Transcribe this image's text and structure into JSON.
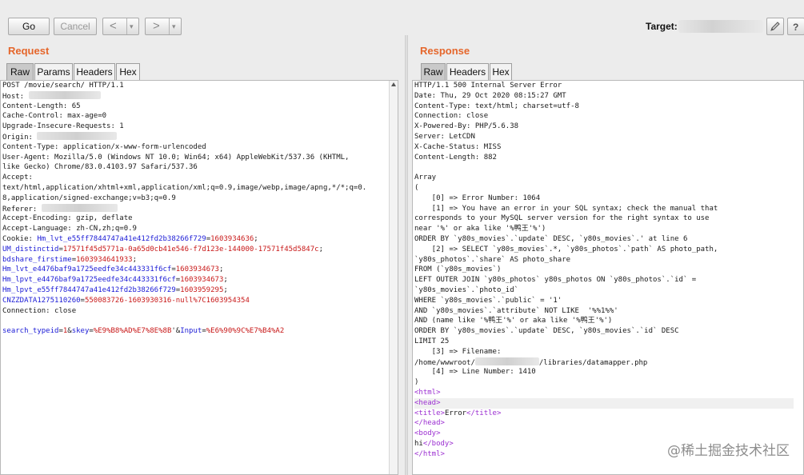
{
  "toolbar": {
    "go_label": "Go",
    "cancel_label": "Cancel",
    "back_glyph": "<",
    "forward_glyph": ">",
    "dropdown_glyph": "▾",
    "target_label": "Target:",
    "edit_icon": "pencil-icon",
    "help_icon": "help-icon"
  },
  "request": {
    "title": "Request",
    "tabs": [
      "Raw",
      "Params",
      "Headers",
      "Hex"
    ],
    "active_tab": "Raw",
    "lines": [
      [
        {
          "t": "POST /movie/search/ HTTP/1.1",
          "c": "hk"
        }
      ],
      [
        {
          "t": "Host: ",
          "c": "hk"
        },
        {
          "r": 90
        }
      ],
      [
        {
          "t": "Content-Length: 65",
          "c": "hk"
        }
      ],
      [
        {
          "t": "Cache-Control: max-age=0",
          "c": "hk"
        }
      ],
      [
        {
          "t": "Upgrade-Insecure-Requests: 1",
          "c": "hk"
        }
      ],
      [
        {
          "t": "Origin: ",
          "c": "hk"
        },
        {
          "r": 100
        }
      ],
      [
        {
          "t": "Content-Type: application/x-www-form-urlencoded",
          "c": "hk"
        }
      ],
      [
        {
          "t": "User-Agent: Mozilla/5.0 (Windows NT 10.0; Win64; x64) AppleWebKit/537.36 (KHTML,",
          "c": "hk"
        }
      ],
      [
        {
          "t": "like Gecko) Chrome/83.0.4103.97 Safari/537.36",
          "c": "hk"
        }
      ],
      [
        {
          "t": "Accept:",
          "c": "hk"
        }
      ],
      [
        {
          "t": "text/html,application/xhtml+xml,application/xml;q=0.9,image/webp,image/apng,*/*;q=0.",
          "c": "hk"
        }
      ],
      [
        {
          "t": "8,application/signed-exchange;v=b3;q=0.9",
          "c": "hk"
        }
      ],
      [
        {
          "t": "Referer: ",
          "c": "hk"
        },
        {
          "r": 95
        }
      ],
      [
        {
          "t": "Accept-Encoding: gzip, deflate",
          "c": "hk"
        }
      ],
      [
        {
          "t": "Accept-Language: zh-CN,zh;q=0.9",
          "c": "hk"
        }
      ],
      [
        {
          "t": "Cookie: ",
          "c": "hk"
        },
        {
          "t": "Hm_lvt_e55ff7844747a41e412fd2b38266f729",
          "c": "ck"
        },
        {
          "t": "=",
          "c": "hk"
        },
        {
          "t": "1603934636",
          "c": "cv"
        },
        {
          "t": ";",
          "c": "hk"
        }
      ],
      [
        {
          "t": "UM_distinctid",
          "c": "ck"
        },
        {
          "t": "=",
          "c": "hk"
        },
        {
          "t": "17571f45d5771a-0a65d0cb41e546-f7d123e-144000-17571f45d5847c",
          "c": "cv"
        },
        {
          "t": ";",
          "c": "hk"
        }
      ],
      [
        {
          "t": "bdshare_firstime",
          "c": "ck"
        },
        {
          "t": "=",
          "c": "hk"
        },
        {
          "t": "1603934641933",
          "c": "cv"
        },
        {
          "t": ";",
          "c": "hk"
        }
      ],
      [
        {
          "t": "Hm_lvt_e4476baf9a1725eedfe34c443331f6cf",
          "c": "ck"
        },
        {
          "t": "=",
          "c": "hk"
        },
        {
          "t": "1603934673",
          "c": "cv"
        },
        {
          "t": ";",
          "c": "hk"
        }
      ],
      [
        {
          "t": "Hm_lpvt_e4476baf9a1725eedfe34c443331f6cf",
          "c": "ck"
        },
        {
          "t": "=",
          "c": "hk"
        },
        {
          "t": "1603934673",
          "c": "cv"
        },
        {
          "t": ";",
          "c": "hk"
        }
      ],
      [
        {
          "t": "Hm_lpvt_e55ff7844747a41e412fd2b38266f729",
          "c": "ck"
        },
        {
          "t": "=",
          "c": "hk"
        },
        {
          "t": "1603959295",
          "c": "cv"
        },
        {
          "t": ";",
          "c": "hk"
        }
      ],
      [
        {
          "t": "CNZZDATA1275110260",
          "c": "ck"
        },
        {
          "t": "=",
          "c": "hk"
        },
        {
          "t": "550083726-1603930316-null%7C1603954354",
          "c": "cv"
        }
      ],
      [
        {
          "t": "Connection: close",
          "c": "hk"
        }
      ],
      [
        {
          "t": " ",
          "c": "hk"
        }
      ],
      [
        {
          "t": "search_typeid",
          "c": "ck"
        },
        {
          "t": "=",
          "c": "hk"
        },
        {
          "t": "1",
          "c": "cv"
        },
        {
          "t": "&",
          "c": "hk"
        },
        {
          "t": "skey",
          "c": "ck"
        },
        {
          "t": "=",
          "c": "hk"
        },
        {
          "t": "%E9%B8%AD%E7%8E%8B",
          "c": "cv"
        },
        {
          "t": "'&",
          "c": "hk"
        },
        {
          "t": "Input",
          "c": "ck"
        },
        {
          "t": "=",
          "c": "hk"
        },
        {
          "t": "%E6%90%9C%E7%B4%A2",
          "c": "cv"
        }
      ]
    ]
  },
  "response": {
    "title": "Response",
    "tabs": [
      "Raw",
      "Headers",
      "Hex"
    ],
    "active_tab": "Raw",
    "lines": [
      [
        {
          "t": "HTTP/1.1 500 Internal Server Error",
          "c": "hv"
        }
      ],
      [
        {
          "t": "Date: Thu, 29 Oct 2020 08:15:27 GMT",
          "c": "hv"
        }
      ],
      [
        {
          "t": "Content-Type: text/html; charset=utf-8",
          "c": "hv"
        }
      ],
      [
        {
          "t": "Connection: close",
          "c": "hv"
        }
      ],
      [
        {
          "t": "X-Powered-By: PHP/5.6.38",
          "c": "hv"
        }
      ],
      [
        {
          "t": "Server: LetCDN",
          "c": "hv"
        }
      ],
      [
        {
          "t": "X-Cache-Status: MISS",
          "c": "hv"
        }
      ],
      [
        {
          "t": "Content-Length: 882",
          "c": "hv"
        }
      ],
      [
        {
          "t": " ",
          "c": "hv"
        }
      ],
      [
        {
          "t": "Array",
          "c": "hv"
        }
      ],
      [
        {
          "t": "(",
          "c": "hv"
        }
      ],
      [
        {
          "t": "    [0] => Error Number: 1064",
          "c": "hv"
        }
      ],
      [
        {
          "t": "    [1] => You have an error in your SQL syntax; check the manual that",
          "c": "hv"
        }
      ],
      [
        {
          "t": "corresponds to your MySQL server version for the right syntax to use",
          "c": "hv"
        }
      ],
      [
        {
          "t": "near '%' or aka like '%鸭王'%')",
          "c": "hv"
        }
      ],
      [
        {
          "t": "ORDER BY `y80s_movies`.`update` DESC, `y80s_movies`.' at line 6",
          "c": "hv"
        }
      ],
      [
        {
          "t": "    [2] => SELECT `y80s_movies`.*, `y80s_photos`.`path` AS photo_path,",
          "c": "hv"
        }
      ],
      [
        {
          "t": "`y80s_photos`.`share` AS photo_share",
          "c": "hv"
        }
      ],
      [
        {
          "t": "FROM (`y80s_movies`)",
          "c": "hv"
        }
      ],
      [
        {
          "t": "LEFT OUTER JOIN `y80s_photos` y80s_photos ON `y80s_photos`.`id` =",
          "c": "hv"
        }
      ],
      [
        {
          "t": "`y80s_movies`.`photo_id`",
          "c": "hv"
        }
      ],
      [
        {
          "t": "WHERE `y80s_movies`.`public` = '1'",
          "c": "hv"
        }
      ],
      [
        {
          "t": "AND `y80s_movies`.`attribute` NOT LIKE  '%%1%%'",
          "c": "hv"
        }
      ],
      [
        {
          "t": "AND (name like '%鸭王'%' or aka like '%鸭王'%')",
          "c": "hv"
        }
      ],
      [
        {
          "t": "ORDER BY `y80s_movies`.`update` DESC, `y80s_movies`.`id` DESC",
          "c": "hv"
        }
      ],
      [
        {
          "t": "LIMIT 25",
          "c": "hv"
        }
      ],
      [
        {
          "t": "    [3] => Filename:",
          "c": "hv"
        }
      ],
      [
        {
          "t": "/home/wwwroot/",
          "c": "hv"
        },
        {
          "r": 80
        },
        {
          "t": "/libraries/datamapper.php",
          "c": "hv"
        }
      ],
      [
        {
          "t": "    [4] => Line Number: 1410",
          "c": "hv"
        }
      ],
      [
        {
          "t": ")",
          "c": "hv"
        }
      ],
      [
        {
          "t": "<html>",
          "c": "tag"
        }
      ],
      [
        {
          "t": "<head>",
          "c": "tag"
        }
      ],
      [
        {
          "t": "<title>",
          "c": "tag"
        },
        {
          "t": "Error",
          "c": "hv"
        },
        {
          "t": "</title>",
          "c": "tag"
        }
      ],
      [
        {
          "t": "</head>",
          "c": "tag"
        }
      ],
      [
        {
          "t": "<body>",
          "c": "tag"
        }
      ],
      [
        {
          "t": "hi",
          "c": "hv"
        },
        {
          "t": "</body>",
          "c": "tag"
        }
      ],
      [
        {
          "t": "</html>",
          "c": "tag"
        }
      ]
    ]
  },
  "watermark": "@稀土掘金技术社区"
}
